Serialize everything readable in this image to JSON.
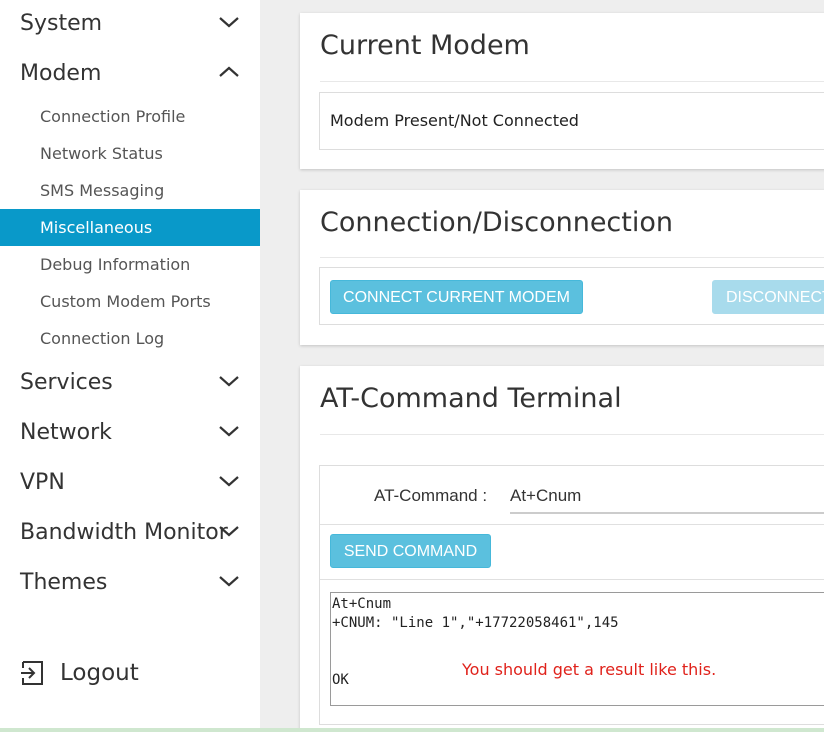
{
  "sidebar": {
    "items": [
      {
        "label": "System",
        "expanded": false
      },
      {
        "label": "Modem",
        "expanded": true
      },
      {
        "label": "Services",
        "expanded": false
      },
      {
        "label": "Network",
        "expanded": false
      },
      {
        "label": "VPN",
        "expanded": false
      },
      {
        "label": "Bandwidth Monitor",
        "expanded": false
      },
      {
        "label": "Themes",
        "expanded": false
      }
    ],
    "modem_subitems": [
      {
        "label": "Connection Profile"
      },
      {
        "label": "Network Status"
      },
      {
        "label": "SMS Messaging"
      },
      {
        "label": "Miscellaneous",
        "active": true
      },
      {
        "label": "Debug Information"
      },
      {
        "label": "Custom Modem Ports"
      },
      {
        "label": "Connection Log"
      }
    ],
    "logout_label": "Logout"
  },
  "current_modem": {
    "title": "Current Modem",
    "status": "Modem Present/Not Connected"
  },
  "connection": {
    "title": "Connection/Disconnection",
    "connect_label": "CONNECT CURRENT MODEM",
    "disconnect_label": "DISCONNECT"
  },
  "terminal": {
    "title": "AT-Command Terminal",
    "field_label": "AT-Command :",
    "command_value": "At+Cnum",
    "send_label": "SEND COMMAND",
    "output": "At+Cnum\n+CNUM: \"Line 1\",\"+17722058461\",145\n\n\nOK",
    "annotation": "You should get a result like this."
  },
  "colors": {
    "accent": "#0999c9",
    "button": "#5bc0de",
    "button_disabled": "#a8dbec",
    "annotation": "#e0221b"
  },
  "icons": {
    "collapse": "chevron-down-icon",
    "expand": "chevron-up-icon",
    "logout": "logout-icon"
  }
}
